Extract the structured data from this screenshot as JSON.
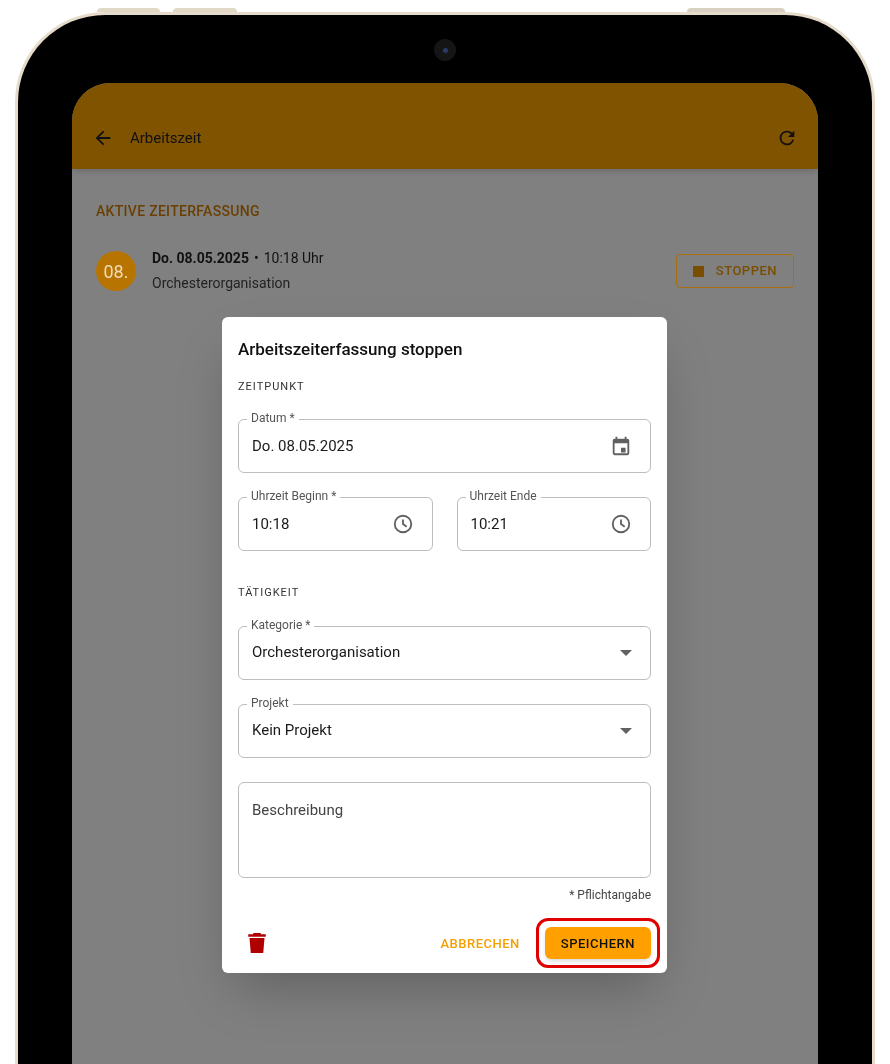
{
  "app_bar": {
    "title": "Arbeitszeit"
  },
  "section": {
    "title": "AKTIVE ZEITERFASSUNG"
  },
  "active_entry": {
    "avatar": "08.",
    "date": "Do. 08.05.2025",
    "time": "10:18 Uhr",
    "separator": "•",
    "category": "Orchesterorganisation",
    "stop_button": "STOPPEN"
  },
  "dialog": {
    "title": "Arbeitszeiterfassung stoppen",
    "groups": [
      {
        "heading": "ZEITPUNKT",
        "rows": [
          [
            {
              "kind": "date",
              "label": "Datum *",
              "value": "Do. 08.05.2025"
            }
          ],
          [
            {
              "kind": "time",
              "label": "Uhrzeit Beginn *",
              "value": "10:18"
            },
            {
              "kind": "time",
              "label": "Uhrzeit Ende",
              "value": "10:21"
            }
          ]
        ]
      },
      {
        "heading": "TÄTIGKEIT",
        "rows": [
          [
            {
              "kind": "select",
              "label": "Kategorie *",
              "value": "Orchesterorganisation"
            }
          ],
          [
            {
              "kind": "select",
              "label": "Projekt",
              "value": "Kein Projekt"
            }
          ],
          [
            {
              "kind": "textarea",
              "placeholder": "Beschreibung"
            }
          ]
        ]
      }
    ],
    "required_note": "* Pflichtangabe",
    "cancel_button": "ABBRECHEN",
    "save_button": {
      "label": "SPEICHERN",
      "highlighted": true
    }
  }
}
